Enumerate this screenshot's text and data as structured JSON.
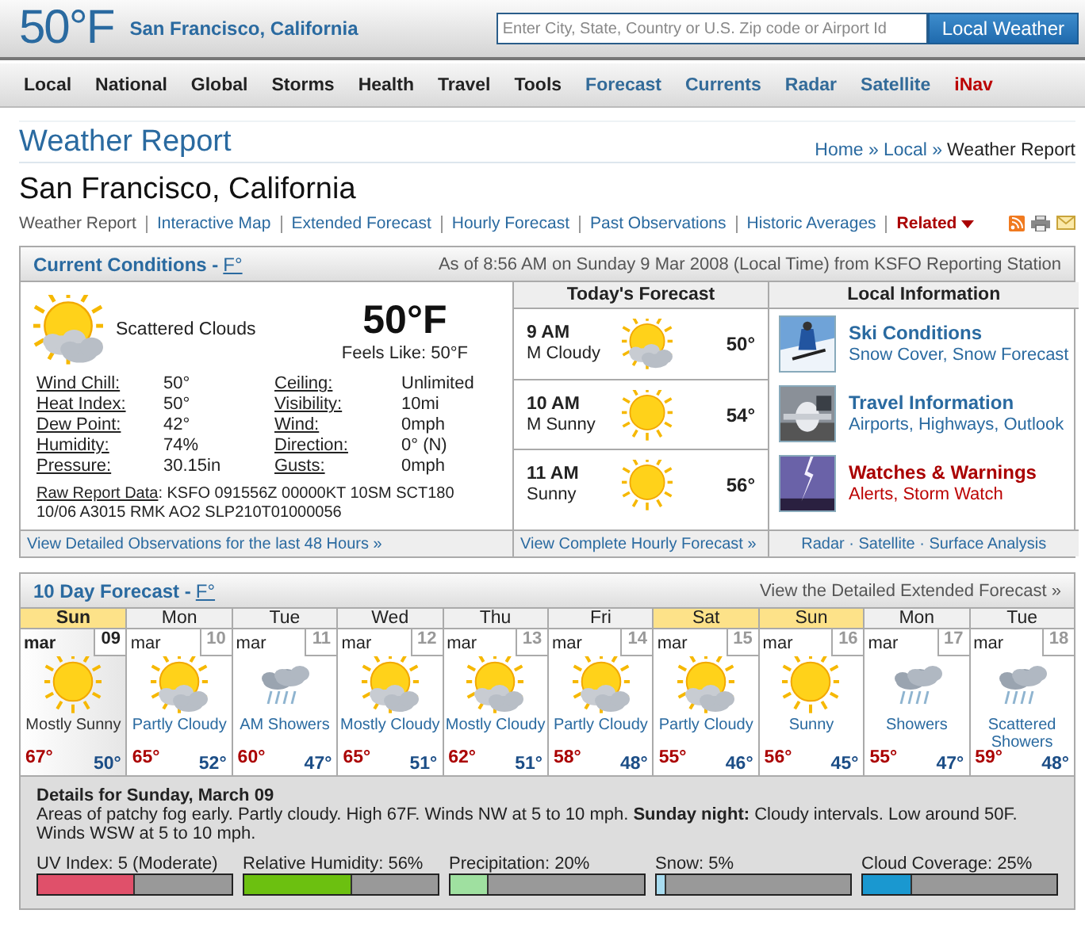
{
  "header": {
    "temperature": "50°F",
    "location": "San Francisco, California",
    "search_placeholder": "Enter City, State, Country or U.S. Zip code or Airport Id",
    "search_button": "Local Weather"
  },
  "nav": [
    {
      "label": "Local",
      "kind": "main"
    },
    {
      "label": "National",
      "kind": "main"
    },
    {
      "label": "Global",
      "kind": "main"
    },
    {
      "label": "Storms",
      "kind": "main"
    },
    {
      "label": "Health",
      "kind": "main"
    },
    {
      "label": "Travel",
      "kind": "main"
    },
    {
      "label": "Tools",
      "kind": "main"
    },
    {
      "label": "Forecast",
      "kind": "section"
    },
    {
      "label": "Currents",
      "kind": "section"
    },
    {
      "label": "Radar",
      "kind": "section"
    },
    {
      "label": "Satellite",
      "kind": "section"
    },
    {
      "label": "iNav",
      "kind": "special"
    }
  ],
  "page_title": "Weather Report",
  "breadcrumb": [
    "Home »",
    "Local »",
    "Weather Report"
  ],
  "city": "San Francisco, California",
  "subnav": [
    {
      "label": "Weather Report",
      "selected": true
    },
    {
      "label": "Interactive Map",
      "selected": false
    },
    {
      "label": "Extended Forecast",
      "selected": false
    },
    {
      "label": "Hourly Forecast",
      "selected": false
    },
    {
      "label": "Past Observations",
      "selected": false
    },
    {
      "label": "Historic Averages",
      "selected": false
    }
  ],
  "related": "Related",
  "current": {
    "title": "Current Conditions -",
    "unit": "F°",
    "as_of": "As of 8:56 AM on Sunday 9 Mar 2008 (Local Time) from KSFO Reporting Station",
    "condition": "Scattered Clouds",
    "temperature": "50°F",
    "feels_like": "Feels Like: 50°F",
    "stats": [
      {
        "label": "Wind Chill:",
        "value": "50°"
      },
      {
        "label": "Ceiling:",
        "value": "Unlimited"
      },
      {
        "label": "Heat Index:",
        "value": "50°"
      },
      {
        "label": "Visibility:",
        "value": "10mi"
      },
      {
        "label": "Dew Point:",
        "value": "42°"
      },
      {
        "label": "Wind:",
        "value": "0mph"
      },
      {
        "label": "Humidity:",
        "value": "74%"
      },
      {
        "label": "Direction:",
        "value": "0° (N)"
      },
      {
        "label": "Pressure:",
        "value": "30.15in"
      },
      {
        "label": "Gusts:",
        "value": "0mph"
      }
    ],
    "raw_label": "Raw Report Data",
    "raw_text": ": KSFO 091556Z 00000KT 10SM SCT180 10/06 A3015 RMK AO2 SLP210T01000056",
    "footer": "View Detailed Observations for the last 48 Hours »"
  },
  "today": {
    "title": "Today's Forecast",
    "rows": [
      {
        "time": "9 AM",
        "condition": "M Cloudy",
        "kind": "partly",
        "temp": "50°"
      },
      {
        "time": "10 AM",
        "condition": "M Sunny",
        "kind": "sun",
        "temp": "54°"
      },
      {
        "time": "11 AM",
        "condition": "Sunny",
        "kind": "sun",
        "temp": "56°"
      }
    ],
    "footer": "View Complete Hourly Forecast »"
  },
  "local_info": {
    "title": "Local Information",
    "items": [
      {
        "title": "Ski Conditions",
        "links": [
          "Snow Cover,",
          "Snow Forecast"
        ],
        "kind": "normal"
      },
      {
        "title": "Travel Information",
        "links": [
          "Airports,",
          "Highways,",
          "Outlook"
        ],
        "kind": "normal"
      },
      {
        "title": "Watches & Warnings",
        "links": [
          "Alerts,",
          "Storm Watch"
        ],
        "kind": "alert"
      }
    ],
    "footer": "Radar · Satellite · Surface Analysis"
  },
  "ten_day": {
    "title": "10 Day Forecast -",
    "unit": "F°",
    "link": "View the Detailed Extended Forecast »",
    "days": [
      {
        "dow": "Sun",
        "month": "mar",
        "date": "09",
        "kind": "sun",
        "condition": "Mostly Sunny",
        "high": "67°",
        "low": "50°",
        "weekend": true,
        "selected": true
      },
      {
        "dow": "Mon",
        "month": "mar",
        "date": "10",
        "kind": "partly",
        "condition": "Partly Cloudy",
        "high": "65°",
        "low": "52°",
        "weekend": false,
        "selected": false
      },
      {
        "dow": "Tue",
        "month": "mar",
        "date": "11",
        "kind": "showers",
        "condition": "AM Showers",
        "high": "60°",
        "low": "47°",
        "weekend": false,
        "selected": false
      },
      {
        "dow": "Wed",
        "month": "mar",
        "date": "12",
        "kind": "partly",
        "condition": "Mostly Cloudy",
        "high": "65°",
        "low": "51°",
        "weekend": false,
        "selected": false
      },
      {
        "dow": "Thu",
        "month": "mar",
        "date": "13",
        "kind": "partly",
        "condition": "Mostly Cloudy",
        "high": "62°",
        "low": "51°",
        "weekend": false,
        "selected": false
      },
      {
        "dow": "Fri",
        "month": "mar",
        "date": "14",
        "kind": "partly",
        "condition": "Partly Cloudy",
        "high": "58°",
        "low": "48°",
        "weekend": false,
        "selected": false
      },
      {
        "dow": "Sat",
        "month": "mar",
        "date": "15",
        "kind": "partly",
        "condition": "Partly Cloudy",
        "high": "55°",
        "low": "46°",
        "weekend": true,
        "selected": false
      },
      {
        "dow": "Sun",
        "month": "mar",
        "date": "16",
        "kind": "sun",
        "condition": "Sunny",
        "high": "56°",
        "low": "45°",
        "weekend": true,
        "selected": false
      },
      {
        "dow": "Mon",
        "month": "mar",
        "date": "17",
        "kind": "showers",
        "condition": "Showers",
        "high": "55°",
        "low": "47°",
        "weekend": false,
        "selected": false
      },
      {
        "dow": "Tue",
        "month": "mar",
        "date": "18",
        "kind": "showers",
        "condition": "Scattered Showers",
        "high": "59°",
        "low": "48°",
        "weekend": false,
        "selected": false
      }
    ]
  },
  "details": {
    "title": "Details for Sunday, March 09",
    "text": "Areas of patchy fog early. Partly cloudy. High 67F. Winds NW at 5 to 10 mph. **Sunday night:** Cloudy intervals. Low around 50F. Winds WSW at 5 to 10 mph.",
    "meters": [
      {
        "label": "UV Index: 5 (Moderate)",
        "level": 0.5,
        "color": "#e0506a"
      },
      {
        "label": "Relative Humidity: 56%",
        "level": 0.56,
        "color": "#6cc010"
      },
      {
        "label": "Precipitation: 20%",
        "level": 0.2,
        "color": "#9fe0a0"
      },
      {
        "label": "Snow: 5%",
        "level": 0.05,
        "color": "#a8dcf0"
      },
      {
        "label": "Cloud Coverage: 25%",
        "level": 0.25,
        "color": "#1a98d0"
      }
    ]
  }
}
